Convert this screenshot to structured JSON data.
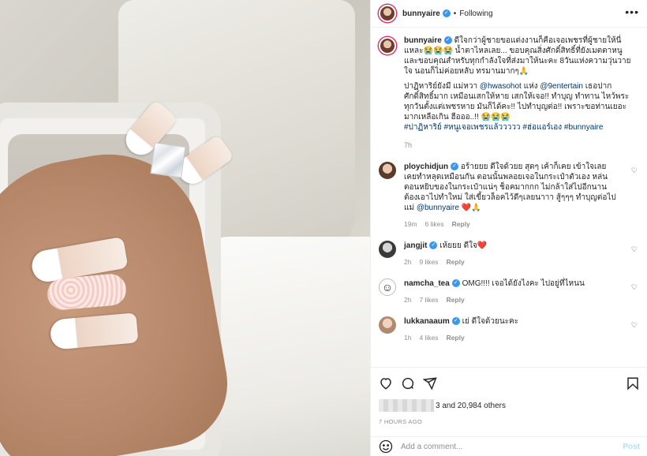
{
  "post": {
    "username": "bunnyaire",
    "follow_status": "Following",
    "separator": "•",
    "more": "•••"
  },
  "caption": {
    "username": "bunnyaire",
    "text": "ดีใจกว่าผู้ชายขอแต่งงานก็คือเจอเพชรที่ผู้ชายให้นี่แหละ😭😭😭 น้ำตาไหลเลย... ขอบคุณสิ่งศักดิ์สิทธิ์ที่ยังเมตตาหนูและขอบคุณสำหรับทุกกำลังใจที่ส่งมาให้นะคะ 8วันแห่งความวุ่นวายใจ นอนก็ไม่ค่อยหลับ ทรมานมากๆ🙏",
    "text2_a": "ปาฏิหาริย์ยังมี แม่หวา ",
    "mention1": "@hwasohot",
    "text2_b": " แห่ง ",
    "mention2": "@9entertain",
    "text2_c": " เธอปากศักดิ์สิทธิ์มาก เหมือนเสกให้หาย เสกให้เจอ!! ทำบุญ ทำทาน ไหว้พระทุกวันตั้งแต่เพชรหาย มันก็ได้คะ!! ไปทำบุญต่อ!! เพราะขอท่านเยอะมากเหลือเกิน ฮือออ..!! 😭😭😭",
    "hashtags": "#ปาฏิหาริย์ #หนูเจอเพชรแล้ววววว #ฮ่อแอร์เอง #bunnyaire",
    "time": "7h"
  },
  "comments": [
    {
      "username": "ploychidjun",
      "text": "อร้ายยย ดีใจด้วยย สุดๆ เค้าก็เคย เข้าใจเลย เคยทำหลุดเหมือนกัน ตอนนั้นพลอยเจอในกระเป๋าตัวเอง หล่นตอนหยิบของในกระเป๋าแน่ๆ ช็อคมากกก ไม่กล้าใส่ไปอีกนาน ต้องเอาไปทำใหม่ ใส่เขี้ยวล็อคไว้ดีๆเลยนาาา สู้ๆๆๆ ทำบุญต่อไปแม่ ",
      "mention": "@bunnyaire",
      "emoji": "❤️🙏",
      "time": "19m",
      "likes": "6 likes",
      "reply": "Reply"
    },
    {
      "username": "jangjit",
      "text": "เห้ยยย ดีใจ",
      "emoji": "❤️",
      "time": "2h",
      "likes": "9 likes",
      "reply": "Reply"
    },
    {
      "username": "namcha_tea",
      "text": "OMG!!!! เจอได้ยังไงคะ ไปอยู่ที่ไหนน",
      "time": "2h",
      "likes": "7 likes",
      "reply": "Reply"
    },
    {
      "username": "lukkanaaum",
      "text": "เย่ ดีใจด้วยนะคะ",
      "time": "1h",
      "likes": "4 likes",
      "reply": "Reply"
    }
  ],
  "likes_text": "3 and 20,984 others",
  "time_ago": "7 HOURS AGO",
  "add_comment": {
    "placeholder": "Add a comment...",
    "post_label": "Post"
  },
  "icons": [
    "heart-icon",
    "comment-icon",
    "share-icon",
    "bookmark-icon",
    "emoji-icon",
    "more-icon",
    "verified-icon"
  ],
  "colors": {
    "link": "#00376b",
    "verified": "#3897f0",
    "post_disabled": "#b2dffc",
    "meta": "#8e8e8e"
  }
}
